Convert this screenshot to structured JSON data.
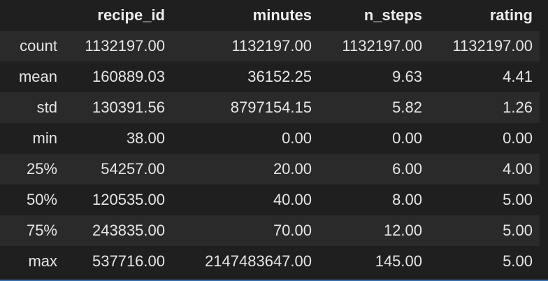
{
  "table": {
    "columns": [
      "recipe_id",
      "minutes",
      "n_steps",
      "rating"
    ],
    "rows": [
      {
        "label": "count",
        "values": [
          "1132197.00",
          "1132197.00",
          "1132197.00",
          "1132197.00"
        ]
      },
      {
        "label": "mean",
        "values": [
          "160889.03",
          "36152.25",
          "9.63",
          "4.41"
        ]
      },
      {
        "label": "std",
        "values": [
          "130391.56",
          "8797154.15",
          "5.82",
          "1.26"
        ]
      },
      {
        "label": "min",
        "values": [
          "38.00",
          "0.00",
          "0.00",
          "0.00"
        ]
      },
      {
        "label": "25%",
        "values": [
          "54257.00",
          "20.00",
          "6.00",
          "4.00"
        ]
      },
      {
        "label": "50%",
        "values": [
          "120535.00",
          "40.00",
          "8.00",
          "5.00"
        ]
      },
      {
        "label": "75%",
        "values": [
          "243835.00",
          "70.00",
          "12.00",
          "5.00"
        ]
      },
      {
        "label": "max",
        "values": [
          "537716.00",
          "2147483647.00",
          "145.00",
          "5.00"
        ]
      }
    ]
  },
  "colors": {
    "background": "#1f1f1f",
    "stripe": "#2a2a2a",
    "text": "#e6e6e6",
    "accent_rule": "#3a6fa8"
  }
}
